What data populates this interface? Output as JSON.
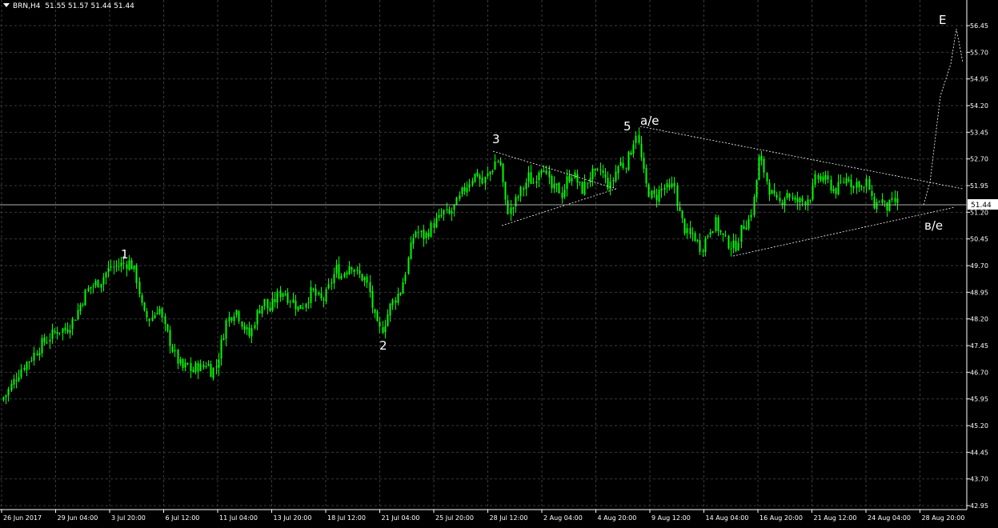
{
  "header": {
    "symbol": "BRN,H4",
    "ohlc": "51.55 51.57 51.44 51.44"
  },
  "colors": {
    "background": "#000000",
    "grid": "#3a3a3a",
    "candle": "#00ff00",
    "axis_text": "#ffffff",
    "price_line": "#b0b0b0",
    "annotation": "#ffffff"
  },
  "chart_data": {
    "type": "candlestick",
    "symbol": "BRN",
    "timeframe": "H4",
    "current_price": "51.44",
    "ylim": [
      42.95,
      56.95
    ],
    "y_ticks": [
      "56.45",
      "55.70",
      "54.95",
      "54.20",
      "53.45",
      "52.70",
      "51.95",
      "51.20",
      "50.45",
      "49.70",
      "48.95",
      "48.20",
      "47.45",
      "46.70",
      "45.95",
      "45.20",
      "44.45",
      "43.70",
      "42.95"
    ],
    "x_ticks": [
      "26 Jun 2017",
      "29 Jun 04:00",
      "3 Jul 20:00",
      "6 Jul 12:00",
      "11 Jul 04:00",
      "13 Jul 20:00",
      "18 Jul 12:00",
      "21 Jul 04:00",
      "25 Jul 20:00",
      "28 Jul 12:00",
      "2 Aug 04:00",
      "4 Aug 20:00",
      "9 Aug 12:00",
      "14 Aug 04:00",
      "16 Aug 20:00",
      "21 Aug 12:00",
      "24 Aug 04:00",
      "28 Aug 20:00"
    ],
    "grid": true,
    "close_path": [
      [
        0,
        45.9
      ],
      [
        8,
        46.1
      ],
      [
        18,
        46.5
      ],
      [
        26,
        46.8
      ],
      [
        34,
        47.0
      ],
      [
        42,
        47.2
      ],
      [
        52,
        47.5
      ],
      [
        62,
        47.7
      ],
      [
        72,
        47.9
      ],
      [
        82,
        47.9
      ],
      [
        92,
        48.2
      ],
      [
        100,
        48.6
      ],
      [
        106,
        48.9
      ],
      [
        112,
        49.1
      ],
      [
        120,
        49.2
      ],
      [
        126,
        49.3
      ],
      [
        132,
        49.5
      ],
      [
        138,
        49.65
      ],
      [
        146,
        49.7
      ],
      [
        155,
        49.75
      ],
      [
        162,
        49.8
      ],
      [
        168,
        49.5
      ],
      [
        172,
        49.2
      ],
      [
        176,
        48.6
      ],
      [
        180,
        48.3
      ],
      [
        186,
        48.2
      ],
      [
        192,
        48.3
      ],
      [
        198,
        48.6
      ],
      [
        204,
        48.0
      ],
      [
        210,
        47.7
      ],
      [
        216,
        47.3
      ],
      [
        222,
        47.0
      ],
      [
        228,
        46.8
      ],
      [
        234,
        46.9
      ],
      [
        240,
        46.7
      ],
      [
        246,
        46.9
      ],
      [
        252,
        46.8
      ],
      [
        258,
        47.0
      ],
      [
        264,
        46.7
      ],
      [
        270,
        46.9
      ],
      [
        276,
        47.5
      ],
      [
        282,
        48.1
      ],
      [
        288,
        48.3
      ],
      [
        294,
        48.5
      ],
      [
        300,
        48.2
      ],
      [
        306,
        47.9
      ],
      [
        312,
        47.7
      ],
      [
        318,
        48.2
      ],
      [
        324,
        48.5
      ],
      [
        330,
        48.7
      ],
      [
        336,
        48.4
      ],
      [
        342,
        48.7
      ],
      [
        348,
        48.9
      ],
      [
        354,
        49.0
      ],
      [
        360,
        48.8
      ],
      [
        366,
        48.7
      ],
      [
        372,
        48.5
      ],
      [
        378,
        48.6
      ],
      [
        384,
        48.8
      ],
      [
        390,
        49.0
      ],
      [
        396,
        48.8
      ],
      [
        402,
        48.7
      ],
      [
        408,
        48.9
      ],
      [
        414,
        49.3
      ],
      [
        420,
        49.6
      ],
      [
        426,
        49.4
      ],
      [
        432,
        49.6
      ],
      [
        438,
        49.8
      ],
      [
        444,
        49.5
      ],
      [
        450,
        49.4
      ],
      [
        456,
        49.3
      ],
      [
        462,
        48.9
      ],
      [
        466,
        48.4
      ],
      [
        470,
        48.0
      ],
      [
        476,
        47.85
      ],
      [
        482,
        48.2
      ],
      [
        488,
        48.6
      ],
      [
        494,
        48.8
      ],
      [
        500,
        49.0
      ],
      [
        506,
        49.5
      ],
      [
        512,
        50.1
      ],
      [
        518,
        50.7
      ],
      [
        524,
        50.6
      ],
      [
        530,
        50.5
      ],
      [
        536,
        50.7
      ],
      [
        542,
        50.9
      ],
      [
        548,
        51.0
      ],
      [
        554,
        51.2
      ],
      [
        560,
        51.1
      ],
      [
        566,
        51.3
      ],
      [
        572,
        51.5
      ],
      [
        578,
        51.8
      ],
      [
        584,
        52.0
      ],
      [
        590,
        52.2
      ],
      [
        596,
        52.3
      ],
      [
        602,
        52.0
      ],
      [
        608,
        52.2
      ],
      [
        614,
        52.4
      ],
      [
        620,
        52.7
      ],
      [
        626,
        52.5
      ],
      [
        630,
        51.5
      ],
      [
        636,
        51.2
      ],
      [
        642,
        51.4
      ],
      [
        648,
        51.7
      ],
      [
        654,
        51.9
      ],
      [
        660,
        52.2
      ],
      [
        666,
        52.0
      ],
      [
        672,
        52.4
      ],
      [
        678,
        52.6
      ],
      [
        684,
        52.1
      ],
      [
        690,
        51.8
      ],
      [
        696,
        51.9
      ],
      [
        702,
        51.7
      ],
      [
        708,
        52.1
      ],
      [
        714,
        52.3
      ],
      [
        720,
        52.1
      ],
      [
        726,
        51.8
      ],
      [
        732,
        52.0
      ],
      [
        738,
        52.3
      ],
      [
        744,
        52.2
      ],
      [
        750,
        52.4
      ],
      [
        756,
        52.1
      ],
      [
        762,
        51.9
      ],
      [
        768,
        52.3
      ],
      [
        774,
        52.6
      ],
      [
        780,
        52.5
      ],
      [
        786,
        52.8
      ],
      [
        790,
        53.1
      ],
      [
        794,
        53.5
      ],
      [
        800,
        52.8
      ],
      [
        806,
        52.0
      ],
      [
        812,
        51.7
      ],
      [
        818,
        51.6
      ],
      [
        824,
        51.8
      ],
      [
        830,
        51.9
      ],
      [
        836,
        51.8
      ],
      [
        842,
        52.0
      ],
      [
        848,
        51.2
      ],
      [
        854,
        50.8
      ],
      [
        860,
        50.5
      ],
      [
        866,
        50.6
      ],
      [
        872,
        50.3
      ],
      [
        876,
        50.2
      ],
      [
        882,
        50.5
      ],
      [
        888,
        50.8
      ],
      [
        894,
        50.9
      ],
      [
        900,
        50.6
      ],
      [
        906,
        50.4
      ],
      [
        912,
        50.3
      ],
      [
        918,
        50.2
      ],
      [
        924,
        50.6
      ],
      [
        930,
        50.9
      ],
      [
        936,
        51.0
      ],
      [
        942,
        51.6
      ],
      [
        948,
        52.7
      ],
      [
        954,
        52.4
      ],
      [
        960,
        51.9
      ],
      [
        966,
        51.6
      ],
      [
        972,
        51.4
      ],
      [
        978,
        51.6
      ],
      [
        984,
        51.8
      ],
      [
        990,
        51.5
      ],
      [
        996,
        51.5
      ],
      [
        1002,
        51.5
      ],
      [
        1008,
        51.6
      ],
      [
        1014,
        51.7
      ],
      [
        1018,
        52.1
      ],
      [
        1024,
        52.2
      ],
      [
        1030,
        52.1
      ],
      [
        1036,
        52.0
      ],
      [
        1042,
        51.8
      ],
      [
        1048,
        51.9
      ],
      [
        1054,
        52.1
      ],
      [
        1060,
        52.2
      ],
      [
        1066,
        51.9
      ],
      [
        1072,
        52.1
      ],
      [
        1078,
        51.8
      ],
      [
        1084,
        52.1
      ],
      [
        1088,
        51.5
      ],
      [
        1094,
        51.4
      ],
      [
        1100,
        51.6
      ],
      [
        1106,
        51.3
      ],
      [
        1112,
        51.4
      ],
      [
        1118,
        51.5
      ],
      [
        1124,
        51.44
      ]
    ]
  },
  "annotations": {
    "w1": "1",
    "w2": "2",
    "w3": "3",
    "w5": "5",
    "ae": "a/e",
    "ve": "в/е",
    "E": "E"
  }
}
